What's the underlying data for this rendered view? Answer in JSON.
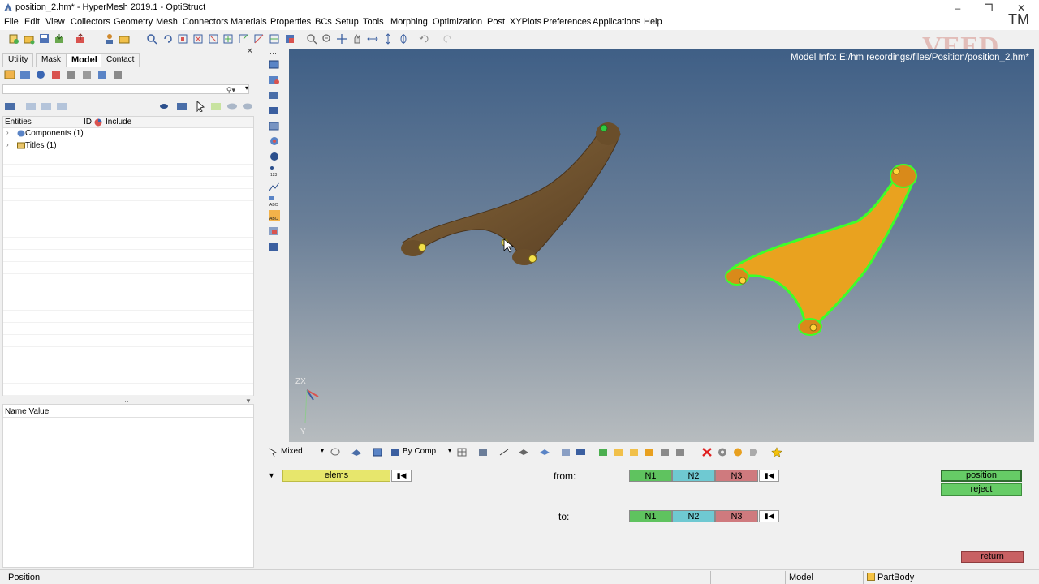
{
  "window": {
    "title": "position_2.hm* - HyperMesh 2019.1 - OptiStruct",
    "icon": "hypermesh-app-icon"
  },
  "menu": [
    "File",
    "Edit",
    "View",
    "Collectors",
    "Geometry",
    "Mesh",
    "Connectors",
    "Materials",
    "Properties",
    "BCs",
    "Setup",
    "Tools",
    "Morphing",
    "Optimization",
    "Post",
    "XYPlots",
    "Preferences",
    "Applications",
    "Help"
  ],
  "watermark": {
    "text": "VEED TUTORIAL",
    "tm": "TM"
  },
  "browser": {
    "tabs": [
      "Utility",
      "Mask",
      "Model",
      "Contact"
    ],
    "active_tab": "Model",
    "columns": [
      "Entities",
      "ID",
      "Include"
    ],
    "rows": [
      "Components (1)",
      "Titles (1)"
    ],
    "name_value_header": "Name Value"
  },
  "viewport": {
    "model_info": "Model Info: E:/hm recordings/files/Position/position_2.hm*",
    "axis": {
      "zx": "ZX",
      "y": "Y"
    },
    "colors": {
      "background_top": "#3f5f86",
      "background_bottom": "#b7bcbf",
      "part_brown": "#7a5a32",
      "part_orange": "#e8a020",
      "highlight_green": "#3dff2a"
    }
  },
  "viewport_toolbar": {
    "display_mode": "Mixed",
    "color_mode": "By Comp"
  },
  "panel": {
    "elems_label": "elems",
    "from_label": "from:",
    "to_label": "to:",
    "node_buttons": [
      "N1",
      "N2",
      "N3"
    ],
    "position_button": "position",
    "reject_button": "reject",
    "return_button": "return"
  },
  "statusbar": {
    "text": "Position",
    "model": "Model",
    "part": "PartBody"
  }
}
